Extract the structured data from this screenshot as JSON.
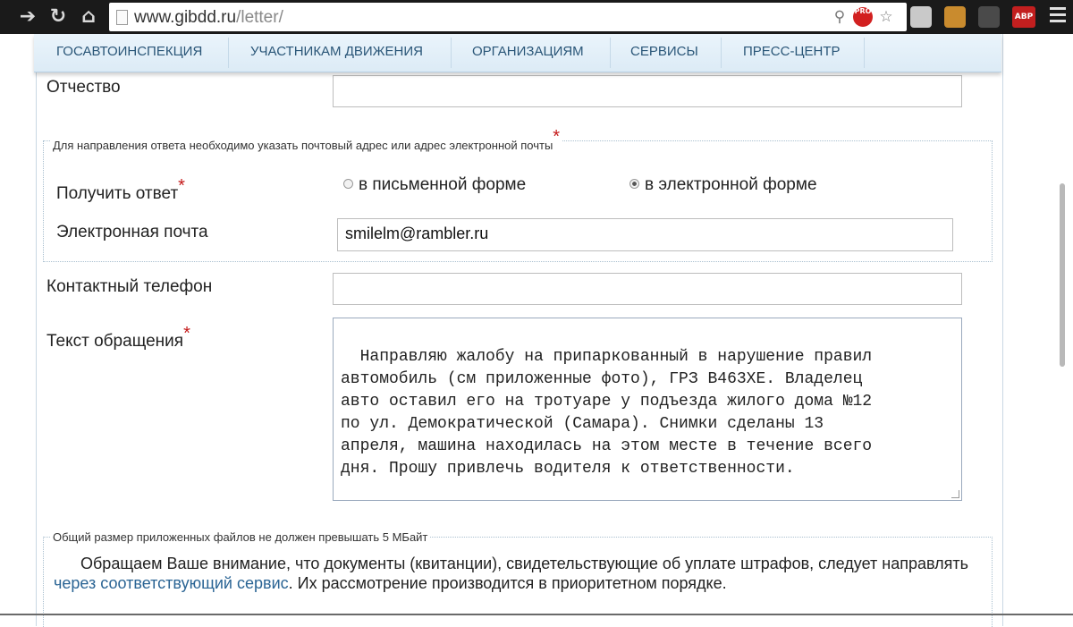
{
  "browser": {
    "url_host": "www.gibdd.ru",
    "url_path": "/letter/",
    "pro_badge": "PRO",
    "abp_badge": "ABP",
    "icons": [
      "forward-arrow-icon",
      "reload-icon",
      "home-icon",
      "page-icon",
      "search-icon",
      "star-icon",
      "menu-icon"
    ]
  },
  "nav": {
    "items": [
      "ГОСАВТОИНСПЕКЦИЯ",
      "УЧАСТНИКАМ ДВИЖЕНИЯ",
      "ОРГАНИЗАЦИЯМ",
      "СЕРВИСЫ",
      "ПРЕСС-ЦЕНТР"
    ]
  },
  "form": {
    "patronymic_label": "Отчество",
    "patronymic_value": "",
    "reply_legend": "Для направления ответа необходимо указать почтовый адрес или адрес электронной почты",
    "required_mark": "*",
    "receive_reply_label": "Получить ответ",
    "option_written": "в письменной форме",
    "option_electronic": "в электронной форме",
    "selected_option": "в электронной форме",
    "email_label": "Электронная почта",
    "email_value": "smilelm@rambler.ru",
    "phone_label": "Контактный телефон",
    "phone_value": "",
    "text_label": "Текст обращения",
    "text_value": "Направляю жалобу на припаркованный в нарушение правил\nавтомобиль (см приложенные фото), ГРЗ В463ХЕ. Владелец\nавто оставил его на тротуаре у подъезда жилого дома №12\nпо ул. Демократической (Самара). Снимки сделаны 13\nапреля, машина находилась на этом месте в течение всего\nдня. Прошу привлечь водителя к ответственности.",
    "files_legend": "Общий размер приложенных файлов не должен превышать 5 МБайт",
    "notice_before": "Обращаем Ваше внимание, что документы (квитанции), свидетельствующие об уплате штрафов, следует направлять ",
    "notice_link": "через соответствующий сервис",
    "notice_after": ". Их рассмотрение производится в приоритетном порядке."
  },
  "colors": {
    "nav_text": "#2a5678",
    "required": "#c41919",
    "link": "#2a6494"
  }
}
